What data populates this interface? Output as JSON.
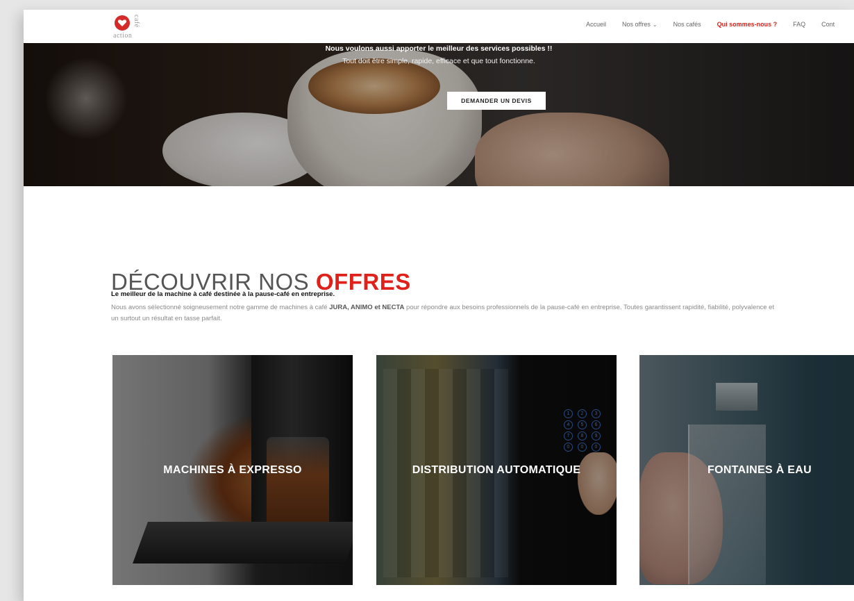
{
  "brand": {
    "logo_word_top": "café",
    "logo_word_bottom": "action"
  },
  "nav": {
    "items": [
      {
        "label": "Accueil"
      },
      {
        "label": "Nos offres"
      },
      {
        "label": "Nos cafés"
      },
      {
        "label": "Qui sommes-nous ?"
      },
      {
        "label": "FAQ"
      },
      {
        "label": "Cont"
      }
    ],
    "active_color": "#e0201b"
  },
  "hero": {
    "line1": "Nous voulons aussi apporter le meilleur des services possibles !!",
    "line2": "Tout doit être simple, rapide, efficace et que tout fonctionne.",
    "cta": "DEMANDER UN DEVIS"
  },
  "offers": {
    "title_prefix": "DÉCOUVRIR NOS ",
    "title_highlight": "OFFRES",
    "lead": "Le meilleur de la machine à café destinée à la pause-café en entreprise.",
    "desc_before": "Nous avons sélectionné soigneusement notre gamme de machines à café ",
    "desc_brands": "JURA, ANIMO et NECTA",
    "desc_after": " pour répondre aux besoins professionnels de la pause-café en entreprise. Toutes garantissent rapidité, fiabilité, polyvalence et un surtout un résultat en tasse parfait.",
    "cards": [
      {
        "label": "MACHINES À EXPRESSO"
      },
      {
        "label": "DISTRIBUTION AUTOMATIQUE"
      },
      {
        "label": "FONTAINES À EAU"
      }
    ]
  },
  "keypad_digits": [
    "1",
    "2",
    "3",
    "4",
    "5",
    "6",
    "7",
    "8",
    "9",
    "0",
    "0",
    "0"
  ],
  "colors": {
    "accent": "#e0201b"
  }
}
